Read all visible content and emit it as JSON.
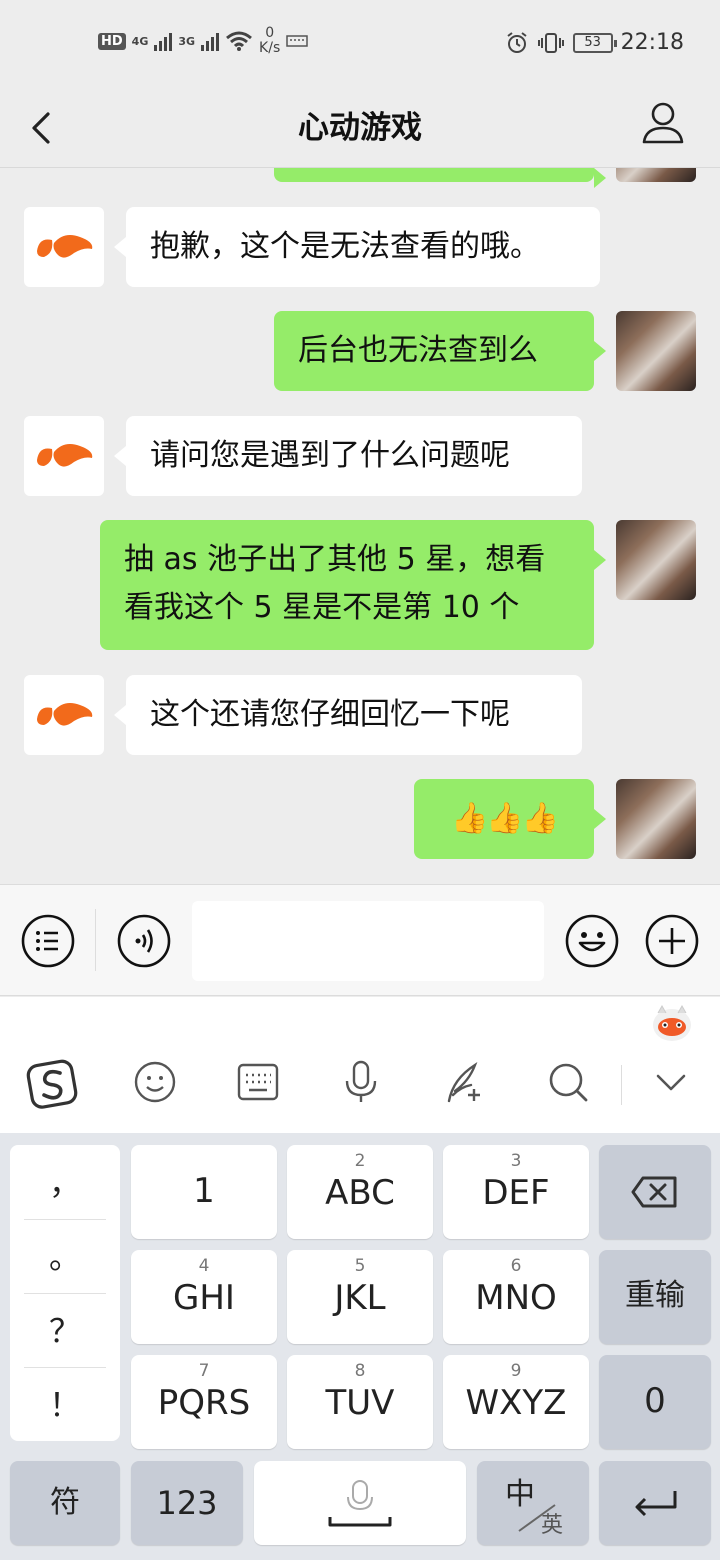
{
  "status_bar": {
    "hd": "HD",
    "net1": "4G",
    "net2": "3G",
    "speed_value": "0",
    "speed_unit": "K/s",
    "battery": "53",
    "time": "22:18"
  },
  "header": {
    "title": "心动游戏",
    "back_icon": "chevron-left-icon",
    "profile_icon": "person-icon"
  },
  "messages": [
    {
      "side": "left",
      "text": "抱歉，这个是无法查看的哦。"
    },
    {
      "side": "right",
      "text": "后台也无法查到么"
    },
    {
      "side": "left",
      "text": "请问您是遇到了什么问题呢"
    },
    {
      "side": "right",
      "text_line1": "抽 as 池子出了其他 5 星，想看",
      "text_line2": "看我这个 5 星是不是第 10 个"
    },
    {
      "side": "left",
      "text": "这个还请您仔细回忆一下呢"
    },
    {
      "side": "right",
      "text": "👍👍👍"
    }
  ],
  "input_bar": {
    "menu_icon": "list-menu-icon",
    "voice_icon": "voice-icon",
    "emoji_icon": "emoji-icon",
    "plus_icon": "plus-icon",
    "placeholder": ""
  },
  "ime_toolbar": [
    "sogou-logo-icon",
    "emoji-icon",
    "keyboard-icon",
    "microphone-icon",
    "handwriting-icon",
    "search-icon",
    "collapse-icon"
  ],
  "keyboard": {
    "punctuation": [
      "，",
      "。",
      "？",
      "！"
    ],
    "keys": [
      {
        "num": "",
        "label": "1"
      },
      {
        "num": "2",
        "label": "ABC"
      },
      {
        "num": "3",
        "label": "DEF"
      },
      {
        "num": "4",
        "label": "GHI"
      },
      {
        "num": "5",
        "label": "JKL"
      },
      {
        "num": "6",
        "label": "MNO"
      },
      {
        "num": "7",
        "label": "PQRS"
      },
      {
        "num": "8",
        "label": "TUV"
      },
      {
        "num": "9",
        "label": "WXYZ"
      }
    ],
    "reinput": "重输",
    "zero": "0",
    "symbols": "符",
    "numbers": "123",
    "lang_main": "中",
    "lang_sub": "英"
  }
}
